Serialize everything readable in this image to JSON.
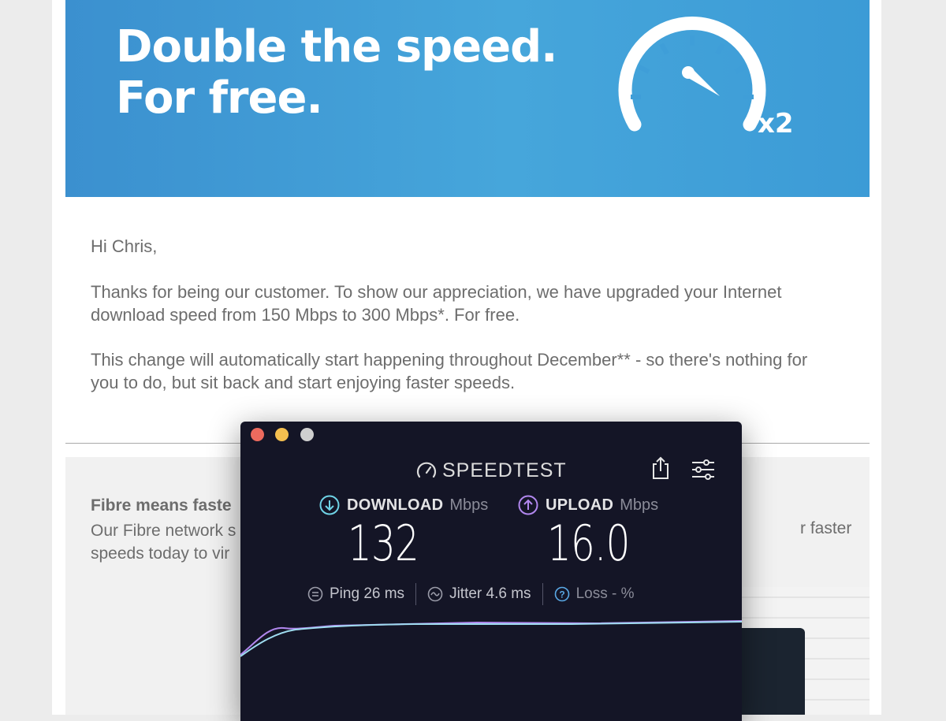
{
  "hero": {
    "line1": "Double the speed.",
    "line2": "For free.",
    "multiplier": "x2"
  },
  "email": {
    "greeting": "Hi Chris,",
    "para1": "Thanks for being our customer.  To show our appreciation, we have upgraded your Internet download speed from 150 Mbps to 300 Mbps*. For free.",
    "para2": "This change will automatically start happening throughout December** - so there's nothing for you to do, but sit back and start enjoying faster speeds."
  },
  "fibre": {
    "heading": "Fibre means faste",
    "text_line1": "Our Fibre network s",
    "text_line2": "speeds today to vir",
    "text_right": "r faster"
  },
  "speedtest": {
    "brand": "SPEEDTEST",
    "download": {
      "label": "DOWNLOAD",
      "unit": "Mbps",
      "value": "132"
    },
    "upload": {
      "label": "UPLOAD",
      "unit": "Mbps",
      "value": "16.0"
    },
    "ping": {
      "label": "Ping",
      "value": "26",
      "unit": "ms"
    },
    "jitter": {
      "label": "Jitter",
      "value": "4.6",
      "unit": "ms"
    },
    "loss": {
      "label": "Loss",
      "value": "-",
      "unit": "%"
    }
  },
  "colors": {
    "hero_blue": "#3b90cf",
    "window_bg": "#141526",
    "download_accent": "#6fd3e6",
    "upload_accent": "#b187ee"
  }
}
